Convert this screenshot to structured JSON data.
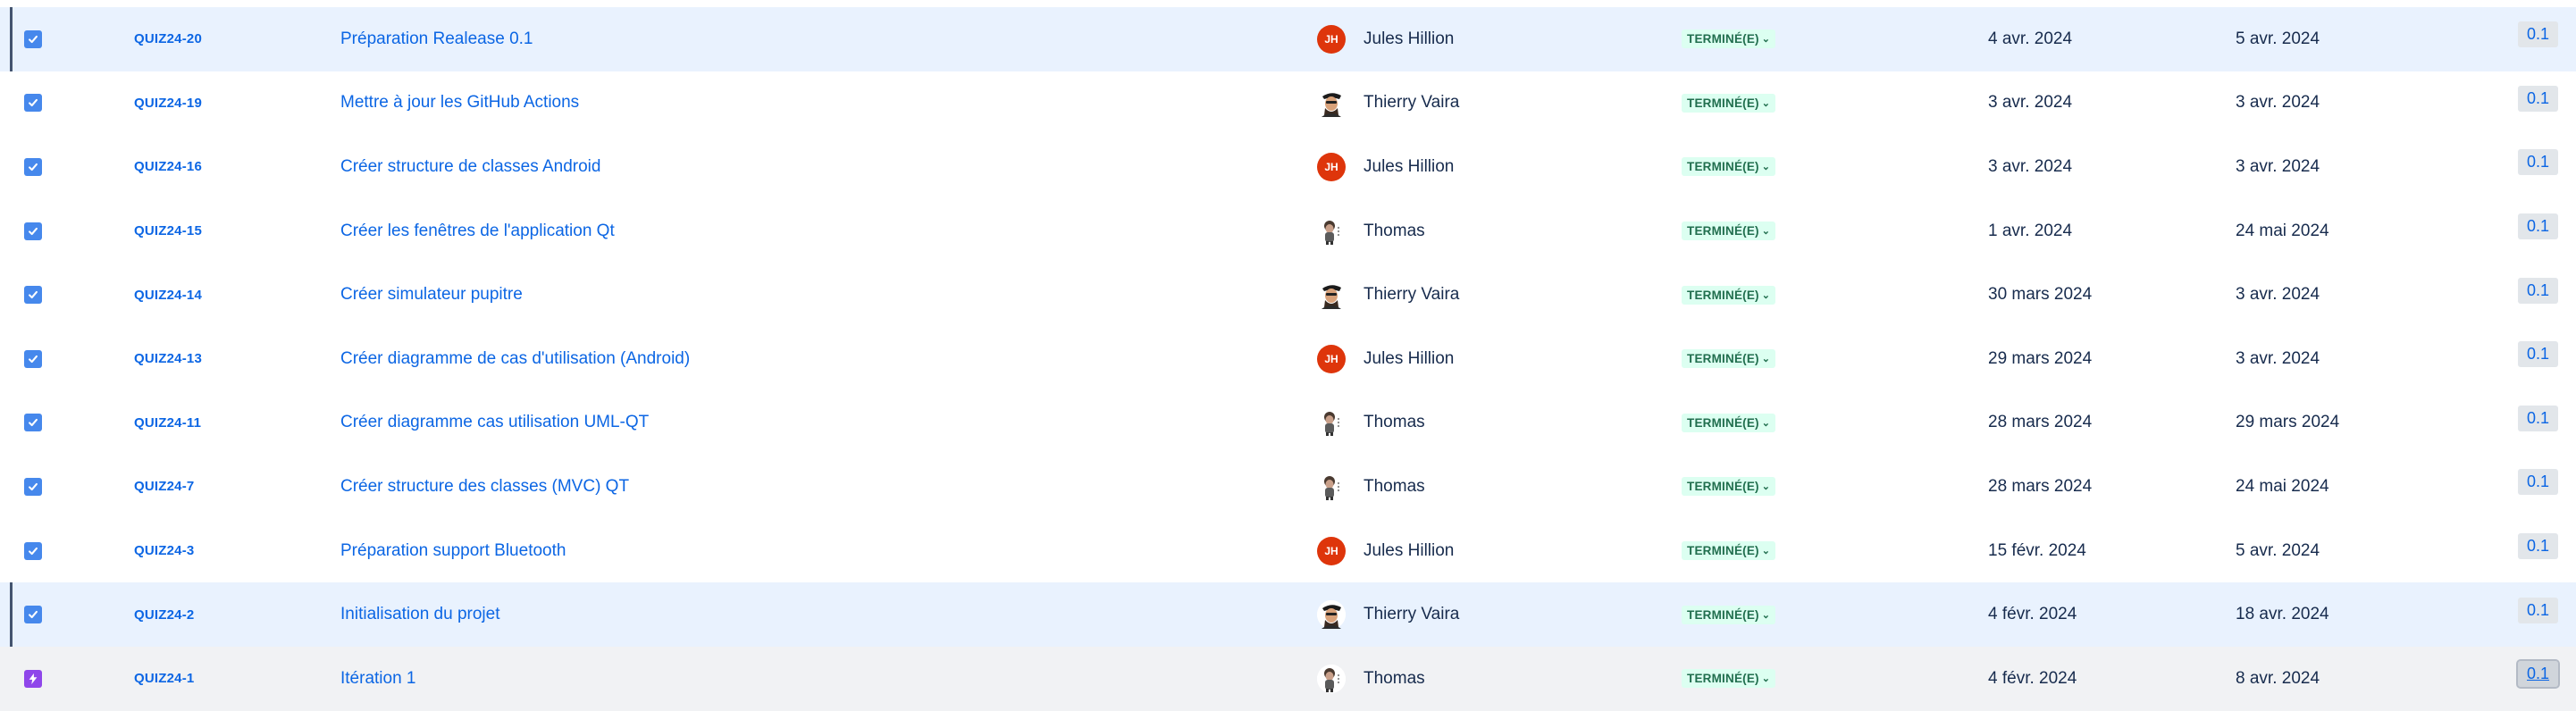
{
  "colors": {
    "key_link": "#0c66e4",
    "status_bg": "#dcfff1",
    "status_text": "#216e4e",
    "avatar_initials_bg": "#de350b",
    "selected_row_bg": "#e9f2fe",
    "task_type": "#4688ec",
    "epic_type": "#8f46ea"
  },
  "rows": [
    {
      "type_icon": "checkbox-icon",
      "key": "QUIZ24-20",
      "summary": "Préparation Realease 0.1",
      "assignee": {
        "initials": "JH",
        "name": "Jules Hillion",
        "avatar": "initials"
      },
      "status": "TERMINÉ(E)",
      "start": "4 avr. 2024",
      "due": "5 avr. 2024",
      "version": "0.1"
    },
    {
      "type_icon": "checkbox-icon",
      "key": "QUIZ24-19",
      "summary": "Mettre à jour les GitHub Actions",
      "assignee": {
        "initials": "",
        "name": "Thierry Vaira",
        "avatar": "photo"
      },
      "status": "TERMINÉ(E)",
      "start": "3 avr. 2024",
      "due": "3 avr. 2024",
      "version": "0.1"
    },
    {
      "type_icon": "checkbox-icon",
      "key": "QUIZ24-16",
      "summary": "Créer structure de classes Android",
      "assignee": {
        "initials": "JH",
        "name": "Jules Hillion",
        "avatar": "initials"
      },
      "status": "TERMINÉ(E)",
      "start": "3 avr. 2024",
      "due": "3 avr. 2024",
      "version": "0.1"
    },
    {
      "type_icon": "checkbox-icon",
      "key": "QUIZ24-15",
      "summary": "Créer les fenêtres de l'application Qt",
      "assignee": {
        "initials": "",
        "name": "Thomas",
        "avatar": "figure"
      },
      "status": "TERMINÉ(E)",
      "start": "1 avr. 2024",
      "due": "24 mai 2024",
      "version": "0.1"
    },
    {
      "type_icon": "checkbox-icon",
      "key": "QUIZ24-14",
      "summary": "Créer simulateur pupitre",
      "assignee": {
        "initials": "",
        "name": "Thierry Vaira",
        "avatar": "photo"
      },
      "status": "TERMINÉ(E)",
      "start": "30 mars 2024",
      "due": "3 avr. 2024",
      "version": "0.1"
    },
    {
      "type_icon": "checkbox-icon",
      "key": "QUIZ24-13",
      "summary": "Créer diagramme de cas d'utilisation (Android)",
      "assignee": {
        "initials": "JH",
        "name": "Jules Hillion",
        "avatar": "initials"
      },
      "status": "TERMINÉ(E)",
      "start": "29 mars 2024",
      "due": "3 avr. 2024",
      "version": "0.1"
    },
    {
      "type_icon": "checkbox-icon",
      "key": "QUIZ24-11",
      "summary": "Créer diagramme cas utilisation UML-QT",
      "assignee": {
        "initials": "",
        "name": "Thomas",
        "avatar": "figure"
      },
      "status": "TERMINÉ(E)",
      "start": "28 mars 2024",
      "due": "29 mars 2024",
      "version": "0.1"
    },
    {
      "type_icon": "checkbox-icon",
      "key": "QUIZ24-7",
      "summary": "Créer structure des classes (MVC) QT",
      "assignee": {
        "initials": "",
        "name": "Thomas",
        "avatar": "figure"
      },
      "status": "TERMINÉ(E)",
      "start": "28 mars 2024",
      "due": "24 mai 2024",
      "version": "0.1"
    },
    {
      "type_icon": "checkbox-icon",
      "key": "QUIZ24-3",
      "summary": "Préparation support Bluetooth",
      "assignee": {
        "initials": "JH",
        "name": "Jules Hillion",
        "avatar": "initials"
      },
      "status": "TERMINÉ(E)",
      "start": "15 févr. 2024",
      "due": "5 avr. 2024",
      "version": "0.1"
    },
    {
      "type_icon": "checkbox-icon",
      "key": "QUIZ24-2",
      "summary": "Initialisation du projet",
      "assignee": {
        "initials": "",
        "name": "Thierry Vaira",
        "avatar": "photo"
      },
      "status": "TERMINÉ(E)",
      "start": "4 févr. 2024",
      "due": "18 avr. 2024",
      "version": "0.1"
    },
    {
      "type_icon": "epic-lightning-icon",
      "key": "QUIZ24-1",
      "summary": "Itération 1",
      "assignee": {
        "initials": "",
        "name": "Thomas",
        "avatar": "figure"
      },
      "status": "TERMINÉ(E)",
      "start": "4 févr. 2024",
      "due": "8 avr. 2024",
      "version": "0.1"
    }
  ]
}
